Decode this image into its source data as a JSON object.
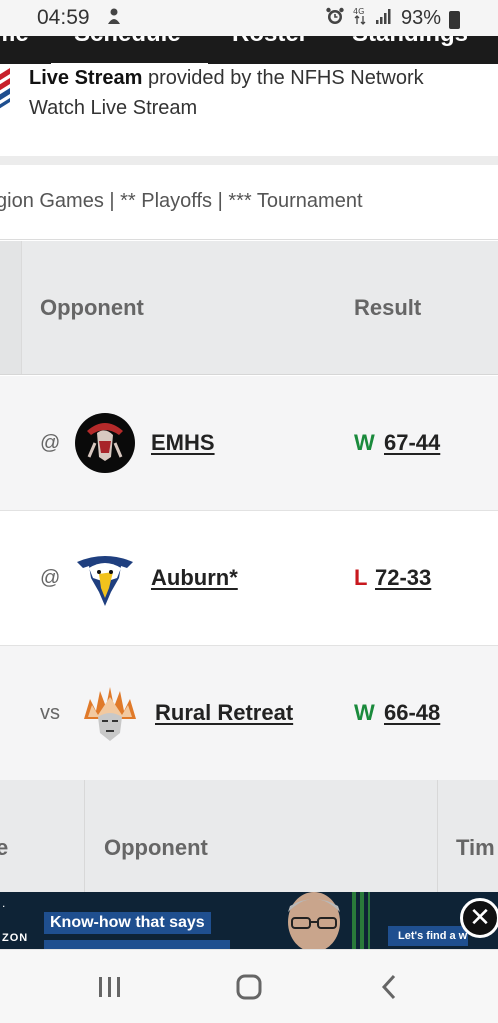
{
  "status_bar": {
    "time": "04:59",
    "battery": "93%",
    "icons": [
      "notification-app-icon",
      "alarm-icon",
      "data-arrows-icon",
      "signal-icon",
      "battery-icon"
    ]
  },
  "nav": {
    "tabs": [
      "me",
      "Schedule",
      "Roster",
      "Standings"
    ],
    "active_tab": "Schedule"
  },
  "live_stream": {
    "bold": "Live Stream",
    "provided": " provided by the NFHS Network",
    "link": "Watch Live Stream"
  },
  "legend": "gion Games | ** Playoffs | *** Tournament",
  "table": {
    "headers": {
      "opponent": "Opponent",
      "result": "Result"
    },
    "rows": [
      {
        "location": "@",
        "team": "EMHS",
        "outcome": "W",
        "score": "67-44"
      },
      {
        "location": "@",
        "team": "Auburn*",
        "outcome": "L",
        "score": "72-33"
      },
      {
        "location": "vs",
        "team": "Rural Retreat",
        "outcome": "W",
        "score": "66-48"
      }
    ]
  },
  "table2": {
    "headers": {
      "first": "e",
      "opponent": "Opponent",
      "time": "Tim"
    }
  },
  "ad": {
    "brand": "ZON",
    "headline": "Know-how that says",
    "cta": "Let's find a w",
    "close": "✕"
  },
  "colors": {
    "win": "#1a8a3c",
    "loss": "#c8181e",
    "navbar": "#1b1b1b",
    "header_bg": "#e9eaeb"
  }
}
